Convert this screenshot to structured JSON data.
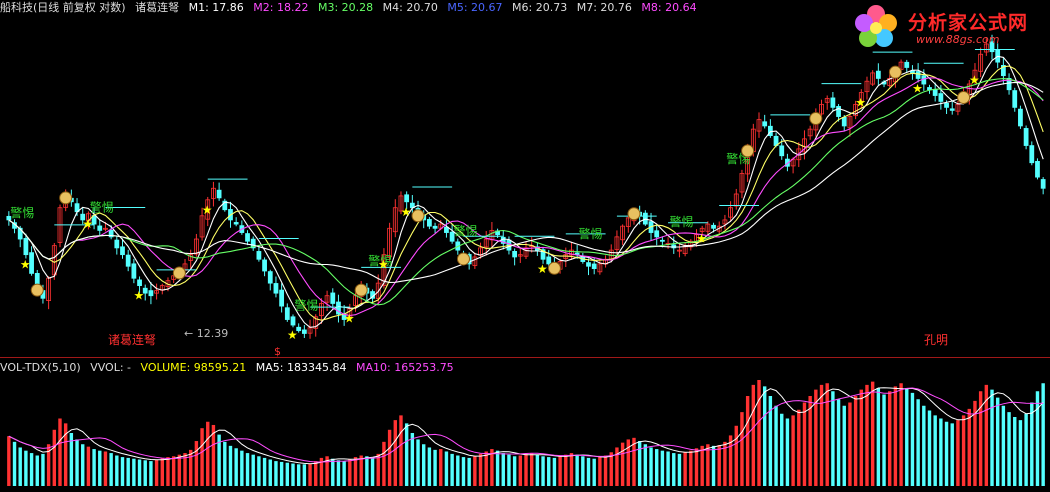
{
  "header": {
    "title": "船科技(日线 前复权 对数)",
    "indicator": "诸葛连弩",
    "mas": [
      {
        "label": "M1: 17.86",
        "color": "#ffffff"
      },
      {
        "label": "M2: 18.22",
        "color": "#ff4cff"
      },
      {
        "label": "M3: 20.28",
        "color": "#66ff66"
      },
      {
        "label": "M4: 20.70",
        "color": "#dddddd"
      },
      {
        "label": "M5: 20.67",
        "color": "#4a66ff"
      },
      {
        "label": "M6: 20.73",
        "color": "#dddddd"
      },
      {
        "label": "M7: 20.76",
        "color": "#dddddd"
      },
      {
        "label": "M8: 20.64",
        "color": "#ff4cff"
      }
    ]
  },
  "logo": {
    "title": "分析家公式网",
    "url": "www.88gs.com"
  },
  "annotations": {
    "warning": "警惕",
    "zhuge": "诸葛连弩",
    "kongming": "孔明",
    "low_price": "← 12.39",
    "dollar": "$"
  },
  "volume_header": {
    "name": "VOL-TDX(5,10)",
    "vvol": "VVOL: -",
    "volume": "VOLUME: 98595.21",
    "ma5": "MA5: 183345.84",
    "ma10": "MA10: 165253.75",
    "colors": {
      "volume": "#ffff00",
      "ma5": "#ffffff",
      "ma10": "#ff4cff"
    }
  },
  "colors": {
    "up": "#ff3232",
    "down": "#54ffff",
    "ma_white": "#ffffff",
    "ma_yellow": "#ffff66",
    "ma_magenta": "#ff4cff",
    "ma_green": "#66ff66",
    "warning_text": "#33dd33",
    "signal_text": "#ff3030",
    "star": "#ffff00",
    "money_bag": "#e8c060"
  },
  "chart_data": [
    {
      "type": "candlestick",
      "title": "",
      "scale": "log",
      "ylim": [
        12.0,
        30.0
      ],
      "price_low_annotation": 12.39,
      "close": [
        17.2,
        16.8,
        16.3,
        15.6,
        14.8,
        14.2,
        13.8,
        14.6,
        16.0,
        17.8,
        18.4,
        18.1,
        17.6,
        17.2,
        17.5,
        17.0,
        16.7,
        16.8,
        16.4,
        15.9,
        15.6,
        15.1,
        14.6,
        14.3,
        14.0,
        13.9,
        14.1,
        14.3,
        14.5,
        14.7,
        14.9,
        15.2,
        15.6,
        16.3,
        17.4,
        18.2,
        18.8,
        18.3,
        17.7,
        17.2,
        17.0,
        16.6,
        16.2,
        15.9,
        15.4,
        14.9,
        14.4,
        14.0,
        13.5,
        13.0,
        12.8,
        12.6,
        12.5,
        12.7,
        13.1,
        13.6,
        13.9,
        13.6,
        13.2,
        13.0,
        13.4,
        13.9,
        14.2,
        14.0,
        13.8,
        14.4,
        15.6,
        16.8,
        17.8,
        18.4,
        18.1,
        17.8,
        17.5,
        17.2,
        16.9,
        16.8,
        17.0,
        16.6,
        16.2,
        15.8,
        15.5,
        15.2,
        15.5,
        15.9,
        16.3,
        16.7,
        16.5,
        16.1,
        15.8,
        15.5,
        15.6,
        15.9,
        16.0,
        15.8,
        15.4,
        15.2,
        15.1,
        15.3,
        15.6,
        15.8,
        15.6,
        15.3,
        15.1,
        15.0,
        15.2,
        15.4,
        15.8,
        16.4,
        16.9,
        17.3,
        17.6,
        17.4,
        17.0,
        16.6,
        16.4,
        16.2,
        16.1,
        15.9,
        15.8,
        16.0,
        16.2,
        16.5,
        16.8,
        17.0,
        16.8,
        16.9,
        17.2,
        17.8,
        18.5,
        19.6,
        21.0,
        22.2,
        22.8,
        22.4,
        21.8,
        21.2,
        20.6,
        20.0,
        20.4,
        21.0,
        21.6,
        22.2,
        23.0,
        23.8,
        24.2,
        23.6,
        23.0,
        22.4,
        23.0,
        23.8,
        24.6,
        25.4,
        26.0,
        25.6,
        25.2,
        25.6,
        26.2,
        26.8,
        26.4,
        26.0,
        25.6,
        25.2,
        24.8,
        24.4,
        24.0,
        23.6,
        23.4,
        23.8,
        24.4,
        25.2,
        26.2,
        27.4,
        28.2,
        27.6,
        26.8,
        25.8,
        24.8,
        23.6,
        22.4,
        21.2,
        20.2,
        19.4,
        18.8
      ],
      "ma_lines": [
        "M1",
        "M2",
        "M3",
        "M4",
        "M5",
        "M6",
        "M7",
        "M8"
      ]
    },
    {
      "type": "bar",
      "title": "",
      "series": [
        {
          "name": "VOLUME",
          "values": [
            62,
            55,
            48,
            44,
            41,
            38,
            40,
            52,
            70,
            84,
            78,
            66,
            58,
            52,
            49,
            46,
            44,
            43,
            41,
            38,
            36,
            35,
            34,
            33,
            32,
            31,
            33,
            35,
            36,
            37,
            39,
            41,
            45,
            56,
            72,
            80,
            76,
            64,
            55,
            50,
            47,
            44,
            41,
            39,
            37,
            35,
            33,
            31,
            30,
            29,
            28,
            27,
            27,
            28,
            31,
            35,
            37,
            34,
            32,
            31,
            33,
            36,
            38,
            37,
            35,
            40,
            55,
            70,
            82,
            88,
            78,
            66,
            58,
            52,
            48,
            45,
            46,
            43,
            40,
            38,
            36,
            35,
            37,
            40,
            43,
            46,
            44,
            41,
            39,
            37,
            38,
            40,
            41,
            39,
            37,
            36,
            35,
            37,
            39,
            41,
            39,
            37,
            35,
            34,
            36,
            38,
            42,
            48,
            54,
            58,
            60,
            56,
            52,
            48,
            46,
            44,
            43,
            41,
            40,
            42,
            44,
            47,
            50,
            52,
            50,
            51,
            55,
            63,
            75,
            92,
            112,
            126,
            132,
            124,
            112,
            100,
            90,
            84,
            88,
            95,
            104,
            112,
            120,
            126,
            128,
            118,
            108,
            100,
            104,
            112,
            120,
            126,
            130,
            122,
            114,
            118,
            124,
            128,
            122,
            116,
            108,
            100,
            94,
            88,
            84,
            80,
            78,
            82,
            88,
            96,
            106,
            118,
            126,
            120,
            110,
            100,
            92,
            86,
            82,
            90,
            104,
            118,
            128
          ]
        },
        {
          "name": "MA5",
          "values": []
        },
        {
          "name": "MA10",
          "values": []
        }
      ]
    }
  ]
}
